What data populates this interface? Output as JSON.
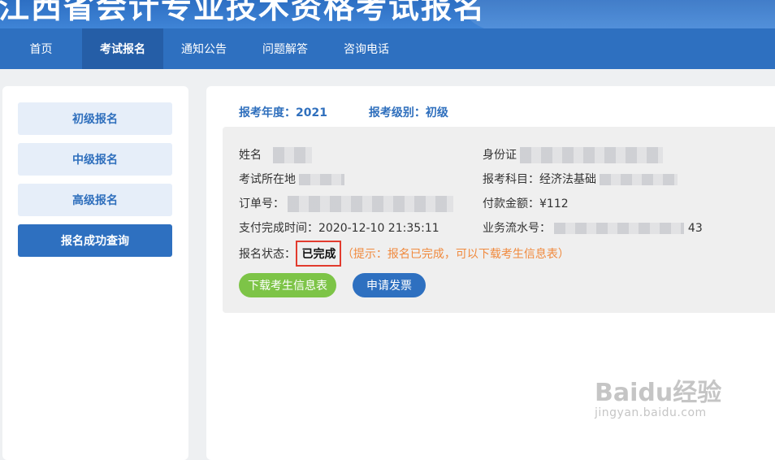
{
  "banner": {
    "title": "江西省会计专业技术资格考试报名"
  },
  "nav": {
    "items": [
      {
        "label": "首页"
      },
      {
        "label": "考试报名"
      },
      {
        "label": "通知公告"
      },
      {
        "label": "问题解答"
      },
      {
        "label": "咨询电话"
      }
    ],
    "active_index": 1
  },
  "sidebar": {
    "items": [
      {
        "label": "初级报名"
      },
      {
        "label": "中级报名"
      },
      {
        "label": "高级报名"
      },
      {
        "label": "报名成功查询"
      }
    ],
    "active_index": 3
  },
  "main": {
    "year_label": "报考年度：2021",
    "level_label": "报考级别：初级",
    "fields": {
      "name_label": "姓名",
      "id_label": "身份证",
      "location_label": "考试所在地",
      "subject_label": "报考科目：经济法基础",
      "order_label": "订单号：",
      "amount_label": "付款金额：¥112",
      "paytime_label": "支付完成时间：2020-12-10 21:35:11",
      "serial_label": "业务流水号：",
      "serial_tail": "43",
      "status_label": "报名状态：",
      "status_value": "已完成",
      "hint": "（提示：报名已完成，可以下载考生信息表）"
    },
    "buttons": {
      "download": "下载考生信息表",
      "invoice": "申请发票"
    }
  },
  "watermark": {
    "main": "Baidu经验",
    "sub": "jingyan.baidu.com"
  },
  "colors": {
    "nav_bg": "#2e70c0",
    "accent_blue": "#2f6fbd",
    "download_green": "#7dc447",
    "hint_orange": "#f08a3e",
    "highlight_red": "#e23b2e"
  }
}
